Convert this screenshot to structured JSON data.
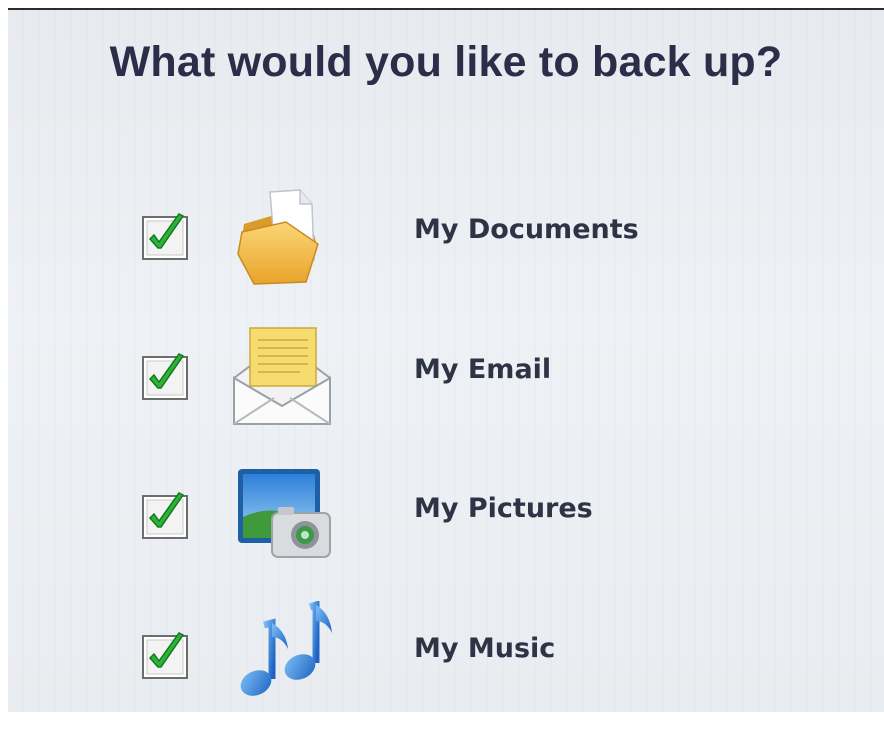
{
  "page": {
    "title": "What would you like to back up?"
  },
  "options": [
    {
      "label": "My Documents",
      "checked": true,
      "icon": "folder-icon"
    },
    {
      "label": "My Email",
      "checked": true,
      "icon": "envelope-icon"
    },
    {
      "label": "My Pictures",
      "checked": true,
      "icon": "camera-photo-icon"
    },
    {
      "label": "My Music",
      "checked": true,
      "icon": "music-notes-icon"
    }
  ],
  "colors": {
    "title": "#2c2d48",
    "label": "#2e3446",
    "check": "#2fb23a",
    "background": "#eceff3"
  }
}
